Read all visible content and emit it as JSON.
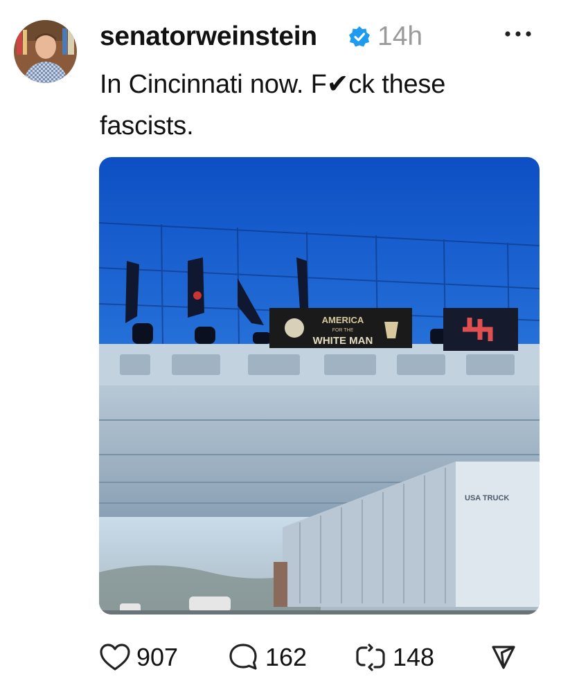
{
  "post": {
    "username": "senatorweinstein",
    "timestamp": "14h",
    "text": "In Cincinnati now. F✔ck these fascists."
  },
  "photo": {
    "banner_line1": "AMERICA",
    "banner_line2": "FOR THE",
    "banner_line3": "WHITE MAN",
    "truck_logo": "USA TRUCK"
  },
  "actions": {
    "likes": "907",
    "replies": "162",
    "reposts": "148"
  },
  "icons": {
    "more": "more-dots-icon",
    "verified": "verified-badge-icon",
    "like": "heart-icon",
    "reply": "comment-icon",
    "repost": "repost-icon",
    "share": "share-icon"
  },
  "colors": {
    "verified": "#1d9bf0",
    "timestamp": "#9a9a9a",
    "text": "#111111"
  }
}
